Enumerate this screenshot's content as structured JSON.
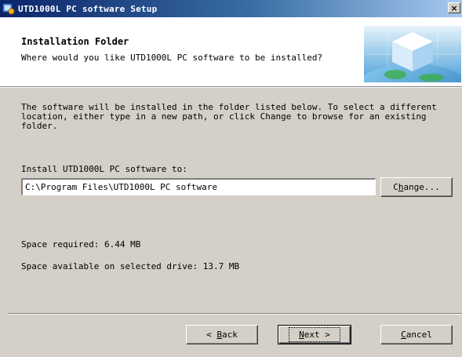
{
  "window": {
    "title": "UTD1000L PC software Setup",
    "close_glyph": "×"
  },
  "header": {
    "title": "Installation Folder",
    "subtitle": "Where would you like UTD1000L PC software to be installed?"
  },
  "body": {
    "description": "The software will be installed in the folder listed below. To select a different location, either type in a new path, or click Change to browse for an existing folder.",
    "install_label": "Install UTD1000L PC software to:",
    "install_path": "C:\\Program Files\\UTD1000L PC software",
    "change_button_pre": "C",
    "change_button_mnemonic": "h",
    "change_button_post": "ange...",
    "space_required": "Space required: 6.44 MB",
    "space_available": "Space available on selected drive: 13.7 MB"
  },
  "footer": {
    "back_pre": "< ",
    "back_mnemonic": "B",
    "back_post": "ack",
    "next_mnemonic": "N",
    "next_post": "ext >",
    "cancel_mnemonic": "C",
    "cancel_post": "ancel"
  },
  "icons": {
    "app": "installer-app-icon",
    "header": "cube-globe-logo-icon",
    "close": "close-icon"
  },
  "colors": {
    "titlebar_start": "#0a246a",
    "titlebar_end": "#a6caf0",
    "dialog_bg": "#d4d0c8",
    "header_bg": "#ffffff"
  }
}
